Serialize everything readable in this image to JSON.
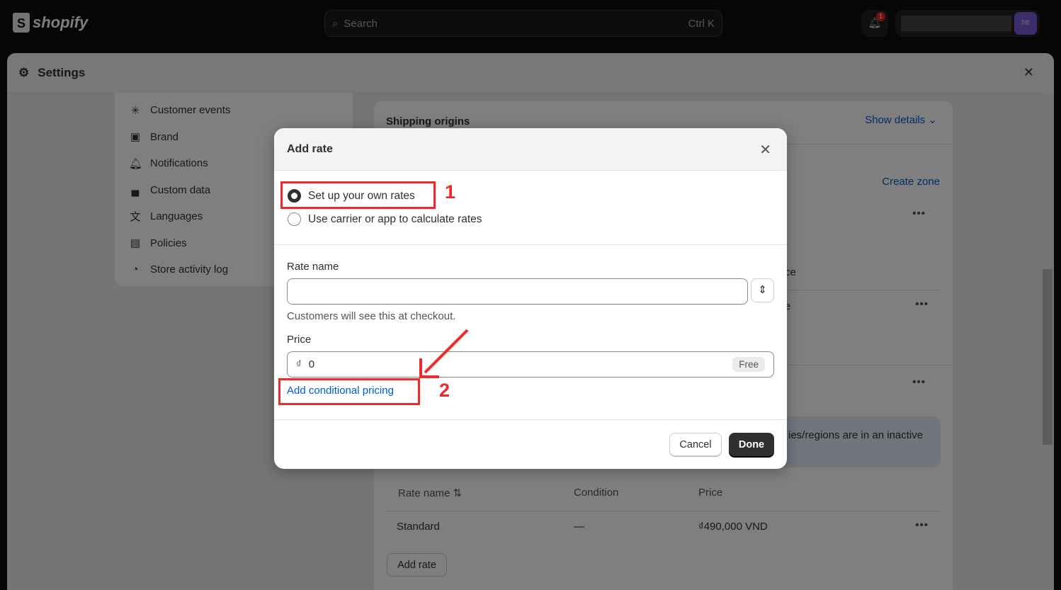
{
  "topbar": {
    "brand": "shopify",
    "search_placeholder": "Search",
    "search_shortcut": "Ctrl K",
    "notification_count": "1",
    "avatar_initials": "htt"
  },
  "settings": {
    "title": "Settings"
  },
  "sidebar": {
    "items": [
      {
        "label": "Customer events",
        "icon": "cursor-click-icon"
      },
      {
        "label": "Brand",
        "icon": "image-icon"
      },
      {
        "label": "Notifications",
        "icon": "bell-icon"
      },
      {
        "label": "Custom data",
        "icon": "blocks-icon"
      },
      {
        "label": "Languages",
        "icon": "translate-icon"
      },
      {
        "label": "Policies",
        "icon": "scroll-icon"
      },
      {
        "label": "Store activity log",
        "icon": "activity-log-icon"
      }
    ]
  },
  "main": {
    "shipping_origins": "Shipping origins",
    "show_details": "Show details",
    "create_zone": "Create zone",
    "partial_1": "ce",
    "partial_2": "e",
    "banner_text": "ies/regions are in an inactive",
    "table": {
      "headers": [
        "Rate name",
        "Condition",
        "Price"
      ],
      "rows": [
        [
          "Standard",
          "—",
          "₫490,000 VND"
        ]
      ]
    },
    "add_rate": "Add rate"
  },
  "modal": {
    "title": "Add rate",
    "options": [
      {
        "label": "Set up your own rates",
        "selected": true
      },
      {
        "label": "Use carrier or app to calculate rates",
        "selected": false
      }
    ],
    "rate_name_label": "Rate name",
    "rate_name_value": "",
    "rate_name_help": "Customers will see this at checkout.",
    "price_label": "Price",
    "currency_symbol": "₫",
    "price_value": "0",
    "price_badge": "Free",
    "conditional_link": "Add conditional pricing",
    "cancel": "Cancel",
    "done": "Done"
  },
  "annotations": {
    "step1": "1",
    "step2": "2",
    "color": "#ee2b2b"
  }
}
